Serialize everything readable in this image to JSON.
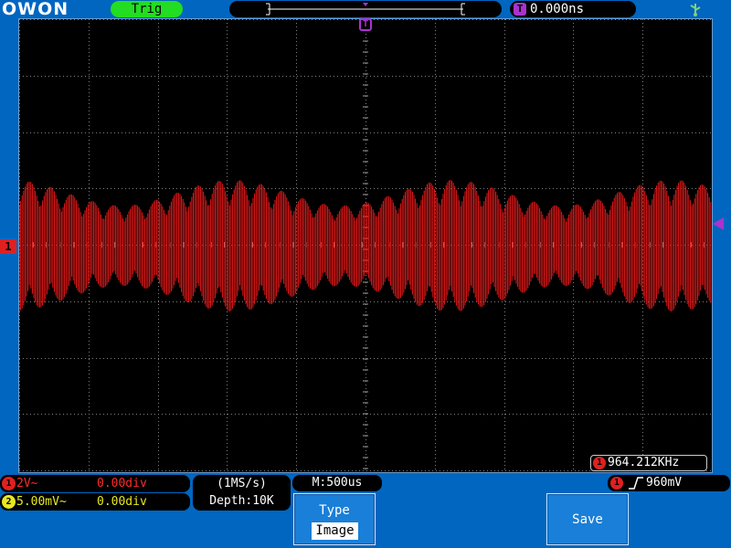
{
  "brand": {
    "logo": "OWON"
  },
  "topbar": {
    "trigger_status": "Trig",
    "trigger_time_badge": "T",
    "trigger_time": "0.000ns",
    "usb_icon": "usb-icon"
  },
  "screen": {
    "ch1_marker": "1",
    "time_marker": "T",
    "frequency": {
      "badge": "1",
      "value": "964.212KHz"
    },
    "waveform": {
      "channel": "CH1",
      "color": "#e01818",
      "shape": "amplitude-modulated sine"
    }
  },
  "channels": [
    {
      "badge": "1",
      "scale": "2V~",
      "offset": "0.00div",
      "color": "#ff2a2a",
      "badge_color": "#e02020"
    },
    {
      "badge": "2",
      "scale": "5.00mV~",
      "offset": "0.00div",
      "color": "#e8e820",
      "badge_color": "#e8e820"
    }
  ],
  "acquisition": {
    "sample_rate": "(1MS/s)",
    "depth": "Depth:10K"
  },
  "timebase": {
    "label": "M:500us"
  },
  "trigger_info": {
    "badge": "1",
    "edge_icon": "rising-edge-icon",
    "level": "960mV"
  },
  "softkeys": {
    "type_label": "Type",
    "type_value": "Image",
    "save_label": "Save"
  },
  "colors": {
    "frame": "#0066c0",
    "trigger_green": "#22dd22",
    "trigger_purple": "#aa33cc",
    "ch1": "#e01818",
    "ch2": "#e8e820"
  }
}
